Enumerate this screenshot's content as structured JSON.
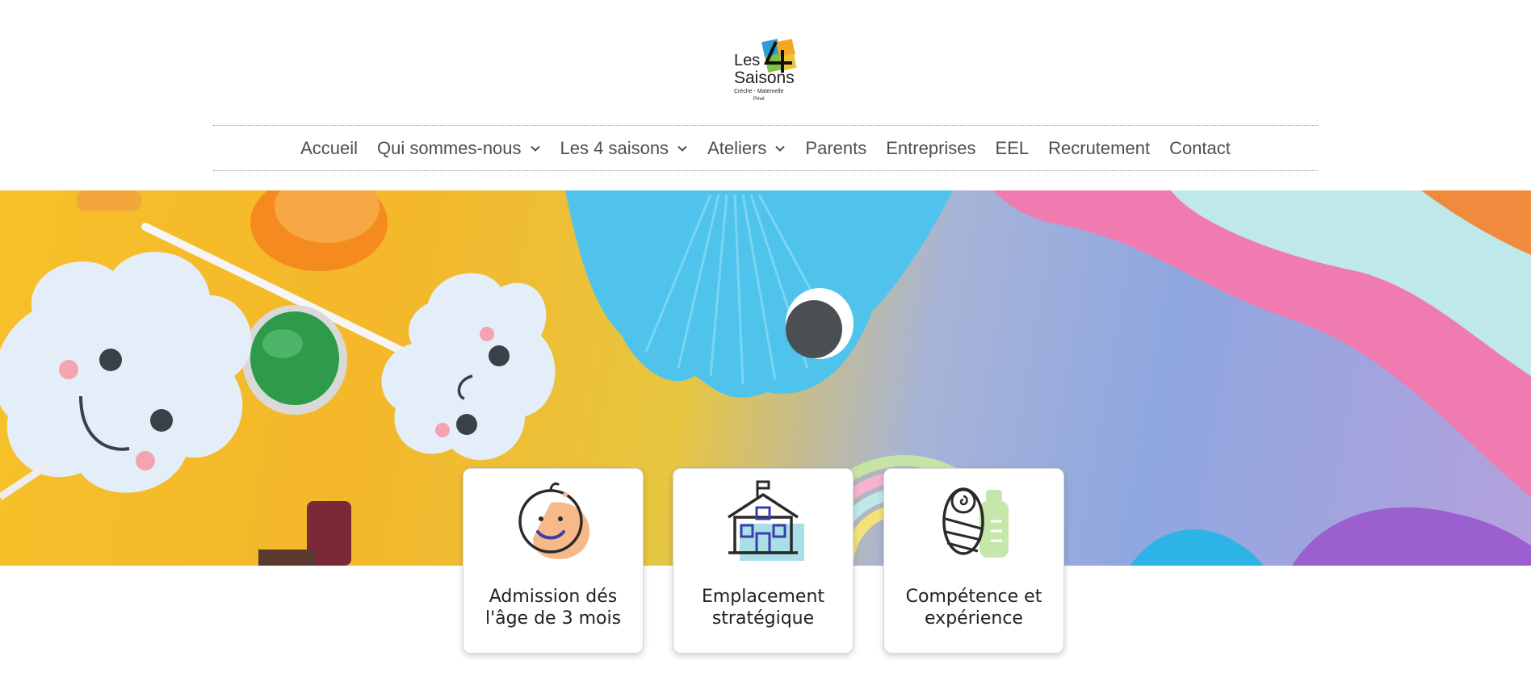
{
  "logo": {
    "line1": "Les",
    "line2": "Saisons",
    "number": "4",
    "tagline": "Crèche - Maternelle",
    "subtag": "Privé",
    "colors": [
      "#2d9dd6",
      "#f5a623",
      "#7dc242",
      "#1a1a1a"
    ]
  },
  "nav": {
    "items": [
      {
        "label": "Accueil",
        "has_dropdown": false
      },
      {
        "label": "Qui sommes-nous",
        "has_dropdown": true
      },
      {
        "label": "Les 4 saisons",
        "has_dropdown": true
      },
      {
        "label": "Ateliers",
        "has_dropdown": true
      },
      {
        "label": "Parents",
        "has_dropdown": false
      },
      {
        "label": "Entreprises",
        "has_dropdown": false
      },
      {
        "label": "EEL",
        "has_dropdown": false
      },
      {
        "label": "Recrutement",
        "has_dropdown": false
      },
      {
        "label": "Contact",
        "has_dropdown": false
      }
    ],
    "text_color": "#4b4f54",
    "chevron_icon": "chevron-down-icon"
  },
  "hero": {
    "image": "colorful-paper-crafts-banner"
  },
  "features": [
    {
      "icon": "baby-face-icon",
      "title": "Admission dés l'âge de 3 mois"
    },
    {
      "icon": "school-house-icon",
      "title": "Emplacement stratégique"
    },
    {
      "icon": "swaddled-baby-bottle-icon",
      "title": "Compétence et expérience"
    }
  ]
}
